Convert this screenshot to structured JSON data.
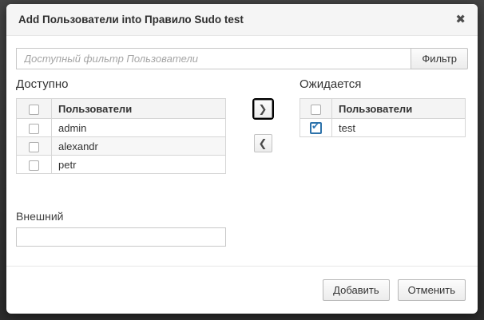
{
  "dialog": {
    "title": "Add Пользователи into Правило Sudo test",
    "close_glyph": "✖"
  },
  "filter": {
    "placeholder": "Доступный фильтр Пользователи",
    "value": "",
    "button_label": "Фильтр"
  },
  "available": {
    "heading": "Доступно",
    "column_header": "Пользователи",
    "select_all_checked": false,
    "rows": [
      {
        "label": "admin",
        "checked": false
      },
      {
        "label": "alexandr",
        "checked": false
      },
      {
        "label": "petr",
        "checked": false
      }
    ]
  },
  "prospective": {
    "heading": "Ожидается",
    "column_header": "Пользователи",
    "select_all_checked": false,
    "rows": [
      {
        "label": "test",
        "checked": true
      }
    ]
  },
  "move_buttons": {
    "add_glyph": "❯",
    "remove_glyph": "❮"
  },
  "icons": {
    "check_glyph": "✔"
  },
  "external": {
    "label": "Внешний",
    "value": ""
  },
  "footer": {
    "add_label": "Добавить",
    "cancel_label": "Отменить"
  },
  "colors": {
    "backdrop": "#383838",
    "header_bg": "#f5f5f5",
    "checkbox_checked": "#2d77b5",
    "focus_ring": "#000000"
  }
}
